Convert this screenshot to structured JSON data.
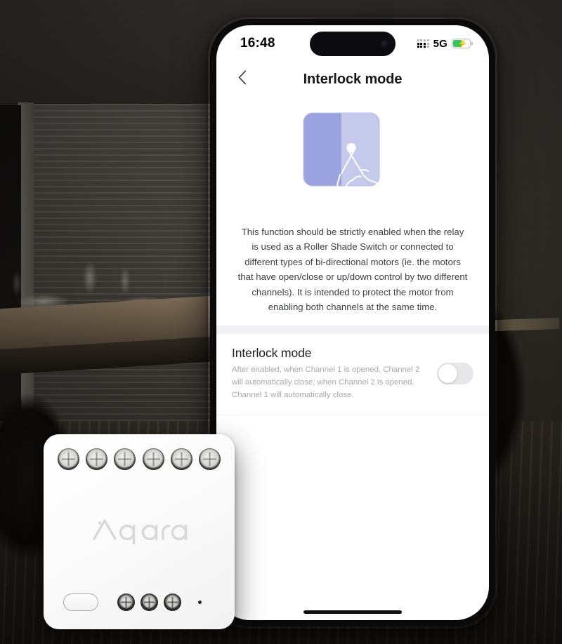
{
  "scene": {
    "background_name": "dark-dining-room-interior",
    "colors": {
      "wall": "#33302c",
      "floor": "#2c2722",
      "window": "#46433d"
    }
  },
  "phone": {
    "device_name": "smartphone-mockup",
    "frame_color": "#0a0a0a",
    "status_bar": {
      "time": "16:48",
      "network_label": "5G",
      "signal_icon": "signal-dots-icon",
      "battery_icon": "battery-charging-icon",
      "battery_level_percent": 58,
      "battery_color": "#34c759",
      "charging": true,
      "bolt_glyph": "⚡"
    },
    "nav_bar": {
      "back_icon": "chevron-left-icon",
      "title": "Interlock mode"
    },
    "home_indicator": "home-indicator-bar"
  },
  "illustration": {
    "name": "interlock-switch-tap-illustration",
    "switch_left_color": "#9ba4e0",
    "switch_right_color": "#c5c9ec",
    "hand_icon": "hand-tap-icon"
  },
  "description": {
    "text": "This function should be strictly enabled when the relay is used as a Roller Shade Switch or connected to different types of bi-directional motors (ie. the motors that have open/close or up/down control by two different channels). It is intended to protect the motor from enabling both channels at the same time."
  },
  "setting": {
    "title": "Interlock mode",
    "subtitle": "After enabled, when Channel 1 is opened, Channel 2 will automatically close; when Channel 2 is opened. Channel 1 will automatically close.",
    "toggle": {
      "name": "interlock-mode-toggle",
      "state": "off",
      "track_color": "#e7e7e9",
      "knob_color": "#ffffff"
    }
  },
  "device": {
    "name": "aqara-dual-relay-module",
    "brand": "Aqara",
    "brand_color": "#d6d6d6",
    "body_color": "#ffffff",
    "top_terminal_count": 6,
    "bottom_terminal_count": 3,
    "button_name": "pairing-button",
    "pinhole_name": "reset-pinhole"
  }
}
